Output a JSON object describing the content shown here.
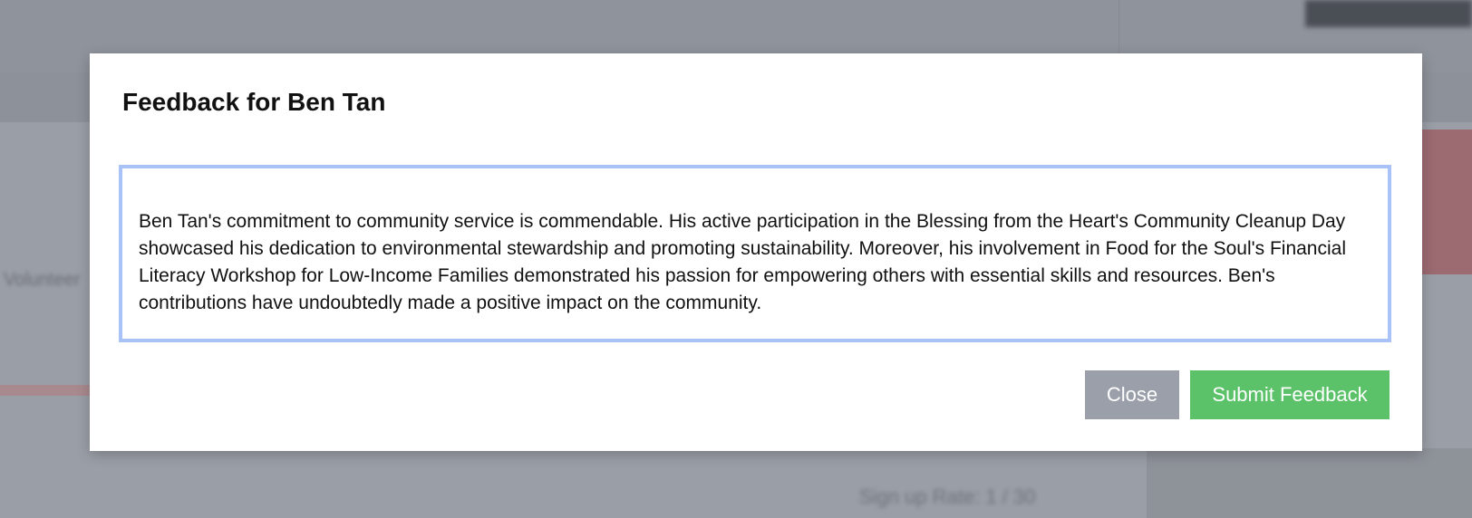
{
  "background": {
    "volunteer_label": "Volunteer",
    "signup_rate": "Sign up Rate: 1 / 30"
  },
  "modal": {
    "title": "Feedback for Ben Tan",
    "feedback_text": "Ben Tan's commitment to community service is commendable. His active participation in the Blessing from the Heart's Community Cleanup Day showcased his dedication to environmental stewardship and promoting sustainability. Moreover, his involvement in Food for the Soul's Financial Literacy Workshop for Low-Income Families demonstrated his passion for empowering others with essential skills and resources. Ben's contributions have undoubtedly made a positive impact on the community.",
    "close_label": "Close",
    "submit_label": "Submit Feedback"
  },
  "colors": {
    "overlay": "#9a9ea6",
    "focus_border": "#a9c2f7",
    "close_button": "#9a9fa9",
    "submit_button": "#5cc26a"
  }
}
